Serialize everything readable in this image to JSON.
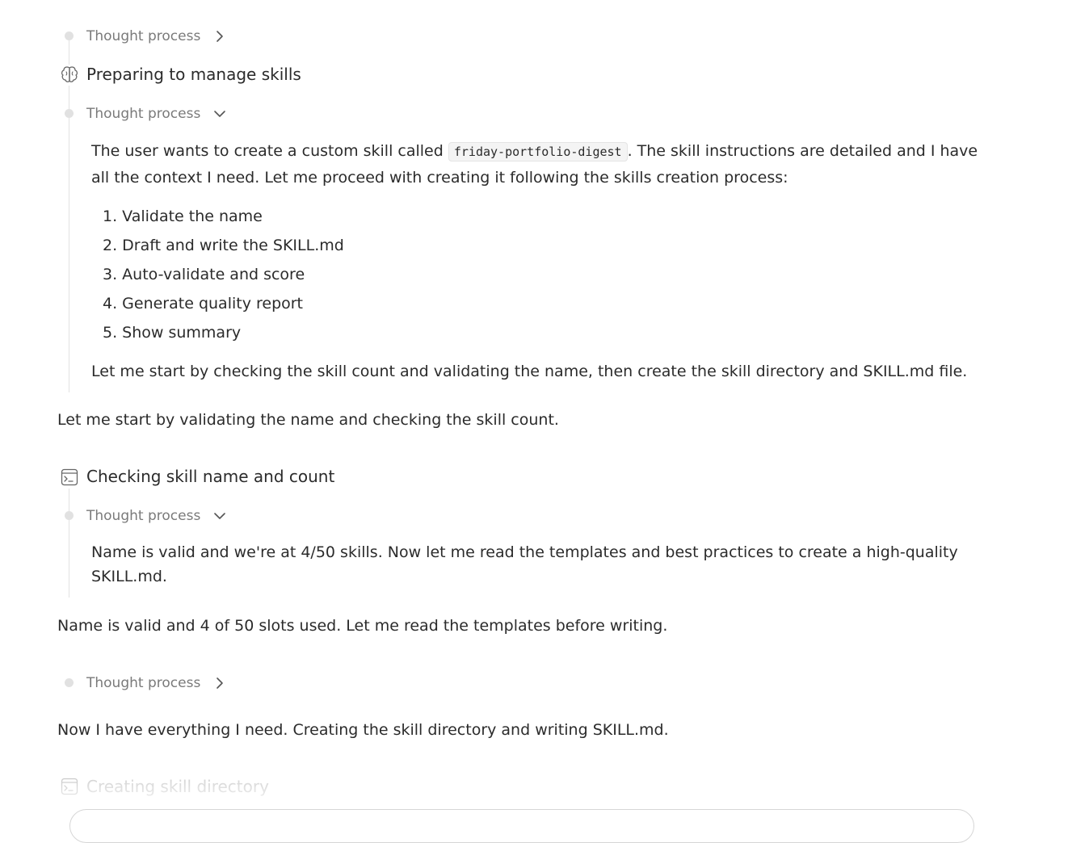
{
  "blocks": {
    "thought_1": {
      "label": "Thought process",
      "expanded": false
    },
    "step_1": {
      "title": "Preparing to manage skills",
      "icon": "brain-icon"
    },
    "thought_2": {
      "label": "Thought process",
      "expanded": true,
      "para_before": "The user wants to create a custom skill called",
      "code": "friday-portfolio-digest",
      "para_after": ". The skill instructions are detailed and I have all the context I need. Let me proceed with creating it following the skills creation process:",
      "list": [
        "1. Validate the name",
        "2. Draft and write the SKILL.md",
        "3. Auto-validate and score",
        "4. Generate quality report",
        "5. Show summary"
      ],
      "closing": "Let me start by checking the skill count and validating the name, then create the skill directory and SKILL.md file."
    },
    "message_1": "Let me start by validating the name and checking the skill count.",
    "step_2": {
      "title": "Checking skill name and count",
      "icon": "terminal-icon"
    },
    "thought_3": {
      "label": "Thought process",
      "expanded": true,
      "text": "Name is valid and we're at 4/50 skills. Now let me read the templates and best practices to create a high-quality SKILL.md."
    },
    "message_2": "Name is valid and 4 of 50 slots used. Let me read the templates before writing.",
    "thought_4": {
      "label": "Thought process",
      "expanded": false
    },
    "message_3": "Now I have everything I need. Creating the skill directory and writing SKILL.md.",
    "step_3": {
      "title": "Creating skill directory",
      "icon": "terminal-icon"
    }
  }
}
